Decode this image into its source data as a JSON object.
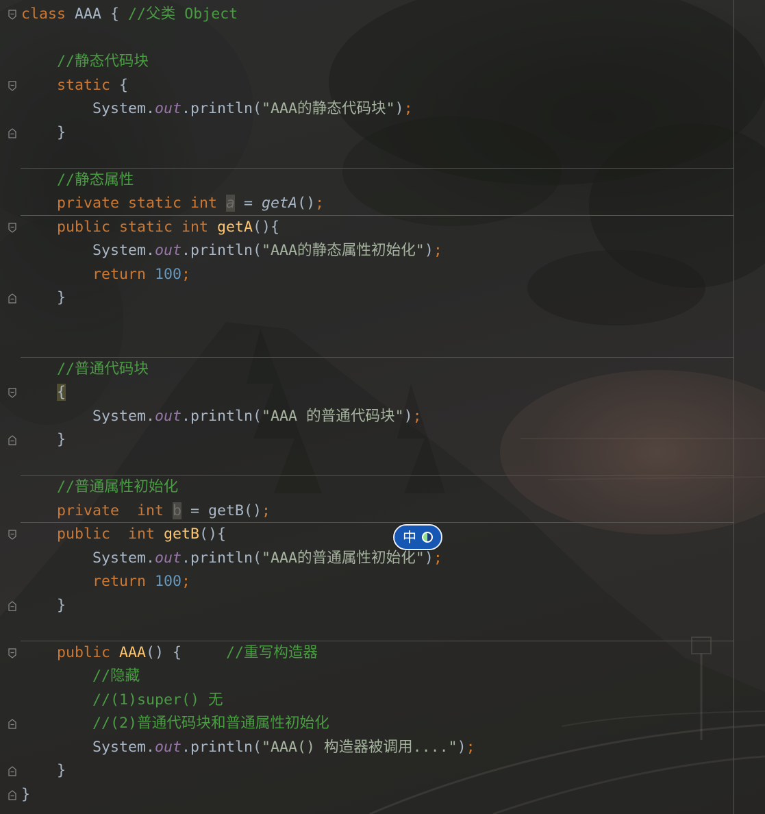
{
  "colors": {
    "keyword": "#CC7832",
    "plain": "#A9B7C6",
    "comment": "#4a9c43",
    "string": "#a7b4a0",
    "number": "#6897BB",
    "static-field": "#9876AA",
    "method-decl": "#FFC66D",
    "unused": "#6e6e6a",
    "unused-bg": "#4a4944",
    "brace-bg": "#514d30",
    "ime-badge": "#1757b4"
  },
  "editor": {
    "lines": [
      {
        "gutter_icon": "fold-start-icon",
        "tokens": [
          {
            "t": "class",
            "k": "keyword"
          },
          {
            "t": " AAA { ",
            "k": "plain"
          },
          {
            "t": "//父类 Object",
            "k": "comment"
          }
        ]
      },
      {
        "tokens": []
      },
      {
        "tokens": [
          {
            "t": "    //静态代码块",
            "k": "comment"
          }
        ]
      },
      {
        "gutter_icon": "fold-start-icon",
        "tokens": [
          {
            "t": "    static",
            "k": "keyword"
          },
          {
            "t": " {",
            "k": "plain"
          }
        ]
      },
      {
        "tokens": [
          {
            "t": "        System.",
            "k": "plain"
          },
          {
            "t": "out",
            "k": "static-field"
          },
          {
            "t": ".println(",
            "k": "plain"
          },
          {
            "t": "\"AAA的静态代码块\"",
            "k": "string"
          },
          {
            "t": ")",
            "k": "plain"
          },
          {
            "t": ";",
            "k": "semicolon"
          }
        ]
      },
      {
        "gutter_icon": "fold-end-icon",
        "tokens": [
          {
            "t": "    }",
            "k": "plain"
          }
        ]
      },
      {
        "tokens": []
      },
      {
        "tokens": [
          {
            "t": "    //静态属性",
            "k": "comment"
          }
        ]
      },
      {
        "tokens": [
          {
            "t": "    private static int ",
            "k": "keyword"
          },
          {
            "t": "a",
            "k": "unused-static-field"
          },
          {
            "t": " = ",
            "k": "plain"
          },
          {
            "t": "getA",
            "k": "static-call"
          },
          {
            "t": "()",
            "k": "plain"
          },
          {
            "t": ";",
            "k": "semicolon"
          }
        ]
      },
      {
        "gutter_icon": "fold-start-icon",
        "tokens": [
          {
            "t": "    public static int ",
            "k": "keyword"
          },
          {
            "t": "getA",
            "k": "method-decl"
          },
          {
            "t": "(){",
            "k": "plain"
          }
        ]
      },
      {
        "tokens": [
          {
            "t": "        System.",
            "k": "plain"
          },
          {
            "t": "out",
            "k": "static-field"
          },
          {
            "t": ".println(",
            "k": "plain"
          },
          {
            "t": "\"AAA的静态属性初始化\"",
            "k": "string"
          },
          {
            "t": ")",
            "k": "plain"
          },
          {
            "t": ";",
            "k": "semicolon"
          }
        ]
      },
      {
        "tokens": [
          {
            "t": "        return ",
            "k": "keyword"
          },
          {
            "t": "100",
            "k": "number"
          },
          {
            "t": ";",
            "k": "semicolon"
          }
        ]
      },
      {
        "gutter_icon": "fold-end-icon",
        "tokens": [
          {
            "t": "    }",
            "k": "plain"
          }
        ]
      },
      {
        "tokens": []
      },
      {
        "tokens": []
      },
      {
        "tokens": [
          {
            "t": "    //普通代码块",
            "k": "comment"
          }
        ]
      },
      {
        "gutter_icon": "fold-start-icon",
        "tokens": [
          {
            "t": "    ",
            "k": "plain"
          },
          {
            "t": "{",
            "k": "matched-brace"
          }
        ]
      },
      {
        "tokens": [
          {
            "t": "        System.",
            "k": "plain"
          },
          {
            "t": "out",
            "k": "static-field"
          },
          {
            "t": ".println(",
            "k": "plain"
          },
          {
            "t": "\"AAA 的普通代码块\"",
            "k": "string"
          },
          {
            "t": ")",
            "k": "plain"
          },
          {
            "t": ";",
            "k": "semicolon"
          }
        ]
      },
      {
        "gutter_icon": "fold-end-icon",
        "tokens": [
          {
            "t": "    }",
            "k": "plain"
          }
        ]
      },
      {
        "tokens": []
      },
      {
        "tokens": [
          {
            "t": "    //普通属性初始化",
            "k": "comment"
          }
        ]
      },
      {
        "tokens": [
          {
            "t": "    private  int ",
            "k": "keyword"
          },
          {
            "t": "b",
            "k": "unused-field"
          },
          {
            "t": " = getB()",
            "k": "plain"
          },
          {
            "t": ";",
            "k": "semicolon"
          }
        ]
      },
      {
        "gutter_icon": "fold-start-icon",
        "tokens": [
          {
            "t": "    public  int ",
            "k": "keyword"
          },
          {
            "t": "getB",
            "k": "method-decl"
          },
          {
            "t": "(){",
            "k": "plain"
          }
        ]
      },
      {
        "tokens": [
          {
            "t": "        System.",
            "k": "plain"
          },
          {
            "t": "out",
            "k": "static-field"
          },
          {
            "t": ".println(",
            "k": "plain"
          },
          {
            "t": "\"AAA的普通属性初始化\"",
            "k": "string"
          },
          {
            "t": ")",
            "k": "plain"
          },
          {
            "t": ";",
            "k": "semicolon"
          }
        ]
      },
      {
        "tokens": [
          {
            "t": "        return ",
            "k": "keyword"
          },
          {
            "t": "100",
            "k": "number"
          },
          {
            "t": ";",
            "k": "semicolon"
          }
        ]
      },
      {
        "gutter_icon": "fold-end-icon",
        "tokens": [
          {
            "t": "    }",
            "k": "plain"
          }
        ]
      },
      {
        "tokens": []
      },
      {
        "gutter_icon": "fold-start-icon",
        "tokens": [
          {
            "t": "    public ",
            "k": "keyword"
          },
          {
            "t": "AAA",
            "k": "method-decl"
          },
          {
            "t": "() {     ",
            "k": "plain"
          },
          {
            "t": "//重写构造器",
            "k": "comment"
          }
        ]
      },
      {
        "tokens": [
          {
            "t": "        //隐藏",
            "k": "comment"
          }
        ]
      },
      {
        "tokens": [
          {
            "t": "        //(1)super() 无",
            "k": "comment"
          }
        ]
      },
      {
        "gutter_icon": "fold-end-icon",
        "tokens": [
          {
            "t": "        //(2)普通代码块和普通属性初始化",
            "k": "comment"
          }
        ]
      },
      {
        "tokens": [
          {
            "t": "        System.",
            "k": "plain"
          },
          {
            "t": "out",
            "k": "static-field"
          },
          {
            "t": ".println(",
            "k": "plain"
          },
          {
            "t": "\"AAA() 构造器被调用....\"",
            "k": "string"
          },
          {
            "t": ")",
            "k": "plain"
          },
          {
            "t": ";",
            "k": "semicolon"
          }
        ]
      },
      {
        "gutter_icon": "fold-end-icon",
        "tokens": [
          {
            "t": "    }",
            "k": "plain"
          }
        ]
      },
      {
        "gutter_icon": "fold-end-icon",
        "tokens": [
          {
            "t": "}",
            "k": "plain"
          }
        ]
      }
    ]
  },
  "ime": {
    "label": "中",
    "icon": "half-circle-icon"
  }
}
